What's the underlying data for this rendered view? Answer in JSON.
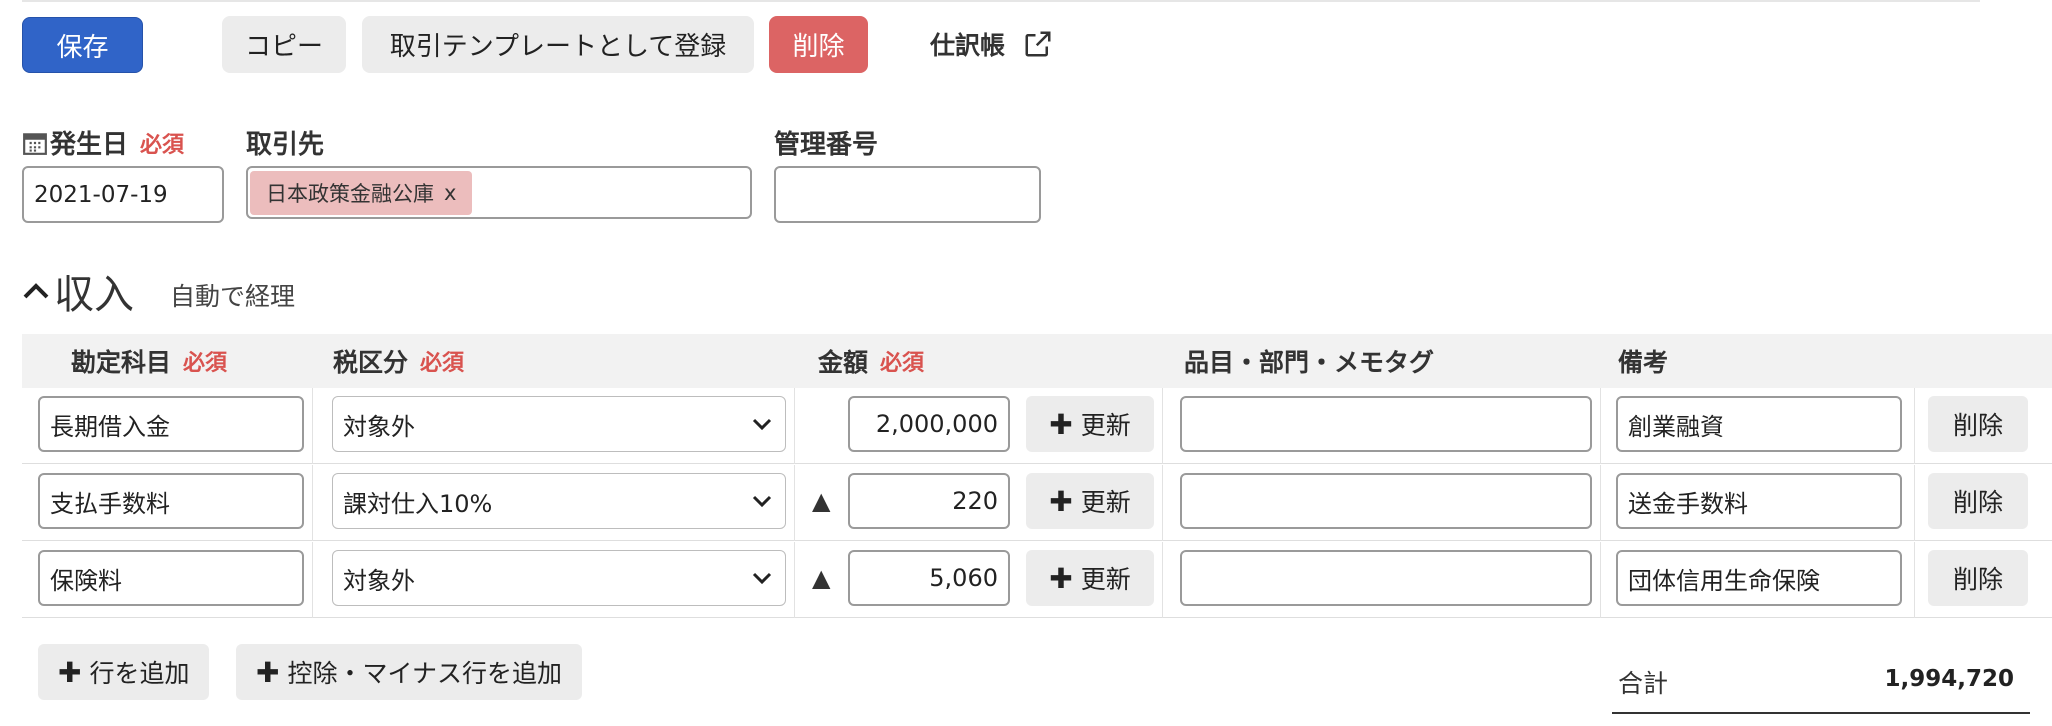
{
  "toolbar": {
    "save_label": "保存",
    "copy_label": "コピー",
    "template_label": "取引テンプレートとして登録",
    "delete_label": "削除",
    "journal_label": "仕訳帳",
    "accent_color": "#3064c8",
    "danger_color": "#dc6464"
  },
  "form": {
    "date_label": "発生日",
    "required_label": "必須",
    "date_value": "2021-07-19",
    "partner_label": "取引先",
    "partner_tag": "日本政策金融公庫",
    "partner_tag_remove": "x",
    "mgmt_label": "管理番号",
    "mgmt_value": ""
  },
  "section": {
    "title": "収入",
    "subtitle": "自動で経理"
  },
  "table": {
    "headers": {
      "account": "勘定科目",
      "tax": "税区分",
      "amount": "金額",
      "item": "品目・部門・メモタグ",
      "note": "備考",
      "required": "必須"
    },
    "update_label": "更新",
    "delete_label": "削除",
    "minus_marker": "▲",
    "rows": [
      {
        "account": "長期借入金",
        "tax": "対象外",
        "minus": "",
        "amount": "2,000,000",
        "item": "",
        "note": "創業融資"
      },
      {
        "account": "支払手数料",
        "tax": "課対仕入10%",
        "minus": "▲",
        "amount": "220",
        "item": "",
        "note": "送金手数料"
      },
      {
        "account": "保険料",
        "tax": "対象外",
        "minus": "▲",
        "amount": "5,060",
        "item": "",
        "note": "団体信用生命保険"
      }
    ]
  },
  "footer": {
    "add_row_label": "行を追加",
    "add_minus_row_label": "控除・マイナス行を追加",
    "total_label": "合計",
    "total_value": "1,994,720"
  }
}
